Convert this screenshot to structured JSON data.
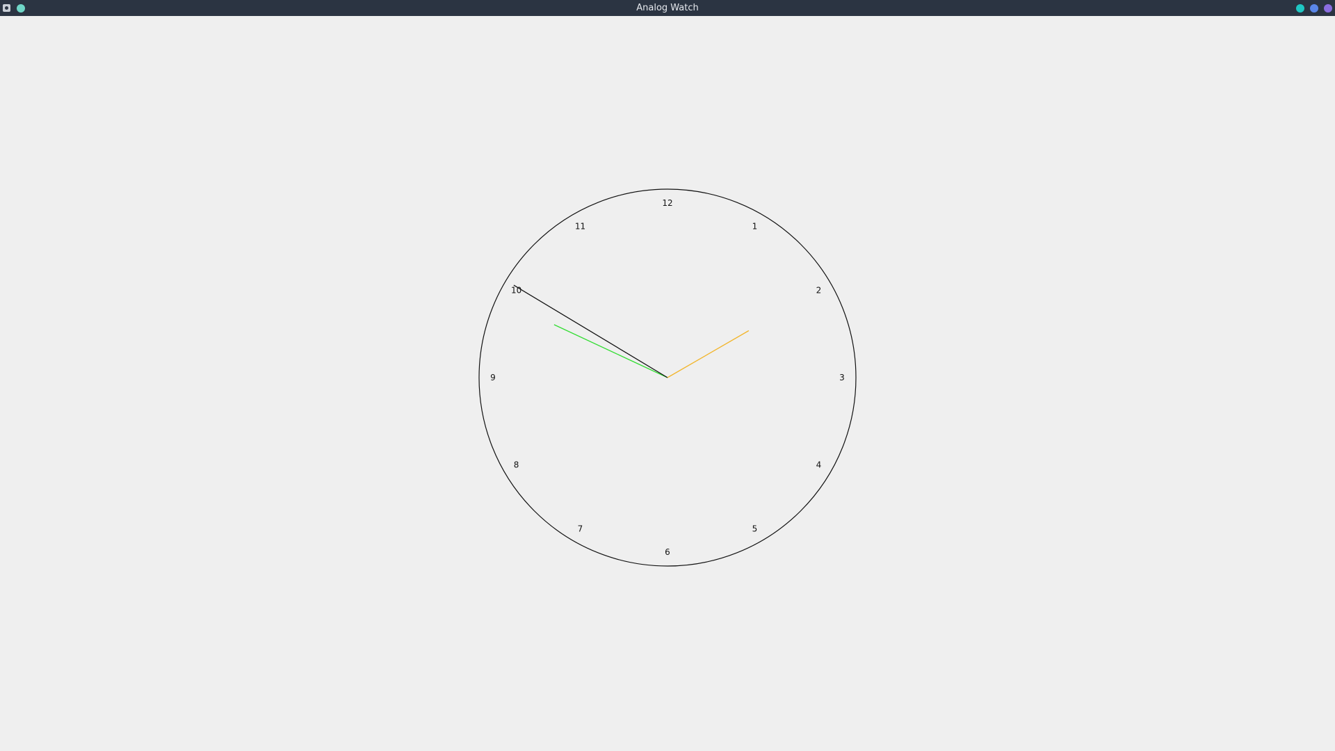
{
  "window": {
    "title": "Analog Watch",
    "icons": {
      "app": "app-icon",
      "pin": "pin-icon",
      "minimize": "minimize-icon",
      "maximize": "maximize-icon",
      "close": "close-icon"
    },
    "colors": {
      "titlebar": "#2b3442",
      "background": "#efefef",
      "minimize": "#1fc7c3",
      "maximize": "#5a86e8",
      "close": "#8a6de0"
    }
  },
  "clock": {
    "numbers": [
      "12",
      "1",
      "2",
      "3",
      "4",
      "5",
      "6",
      "7",
      "8",
      "9",
      "10",
      "11"
    ],
    "time": {
      "hours": 9,
      "minutes": 50,
      "seconds": 10
    },
    "hand_colors": {
      "hour": "#33dd33",
      "minute": "#111111",
      "second": "#f2b52a"
    },
    "face_color": "#111111"
  }
}
